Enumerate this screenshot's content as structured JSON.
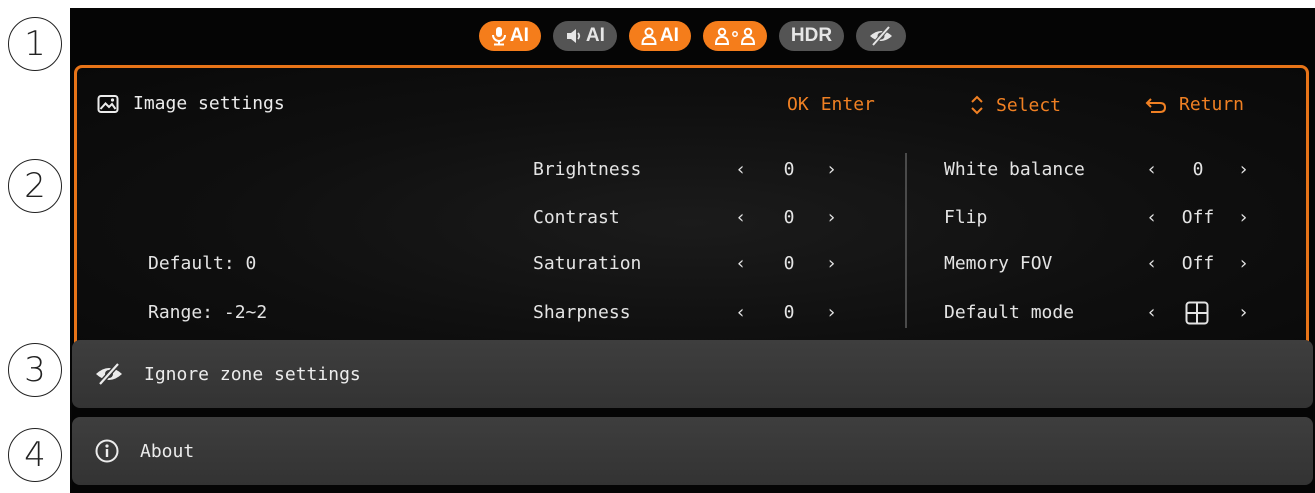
{
  "callouts": [
    "1",
    "2",
    "3",
    "4"
  ],
  "mode_bar": [
    {
      "icon": "microphone-icon",
      "label": "AI",
      "active": true
    },
    {
      "icon": "speaker-icon",
      "label": "AI",
      "active": false
    },
    {
      "icon": "person-icon",
      "label": "AI",
      "active": true
    },
    {
      "icon": "people-icon",
      "label": "",
      "active": true
    },
    {
      "icon": "hdr-icon",
      "label": "HDR",
      "active": false
    },
    {
      "icon": "eye-slash-icon",
      "label": "",
      "active": false
    }
  ],
  "image_settings": {
    "title": "Image settings",
    "hints": {
      "ok_key": "OK",
      "ok_action": "Enter",
      "select": "Select",
      "return": "Return"
    },
    "left_info": {
      "default": "Default: 0",
      "range": "Range: -2~2"
    },
    "left_column": [
      {
        "label": "Brightness",
        "value": "0"
      },
      {
        "label": "Contrast",
        "value": "0"
      },
      {
        "label": "Saturation",
        "value": "0"
      },
      {
        "label": "Sharpness",
        "value": "0"
      }
    ],
    "right_column": [
      {
        "label": "White balance",
        "value": "0"
      },
      {
        "label": "Flip",
        "value": "Off"
      },
      {
        "label": "Memory FOV",
        "value": "Off"
      },
      {
        "label": "Default mode",
        "value": "",
        "icon": "grid-icon"
      }
    ],
    "arrow_left": "‹",
    "arrow_right": "›"
  },
  "menu": {
    "ignore_zone": "Ignore zone settings",
    "about": "About"
  },
  "colors": {
    "accent": "#f57d1b",
    "inactive_pill": "#545454",
    "panel_border": "#e87418",
    "bar": "#3a3a3a"
  }
}
